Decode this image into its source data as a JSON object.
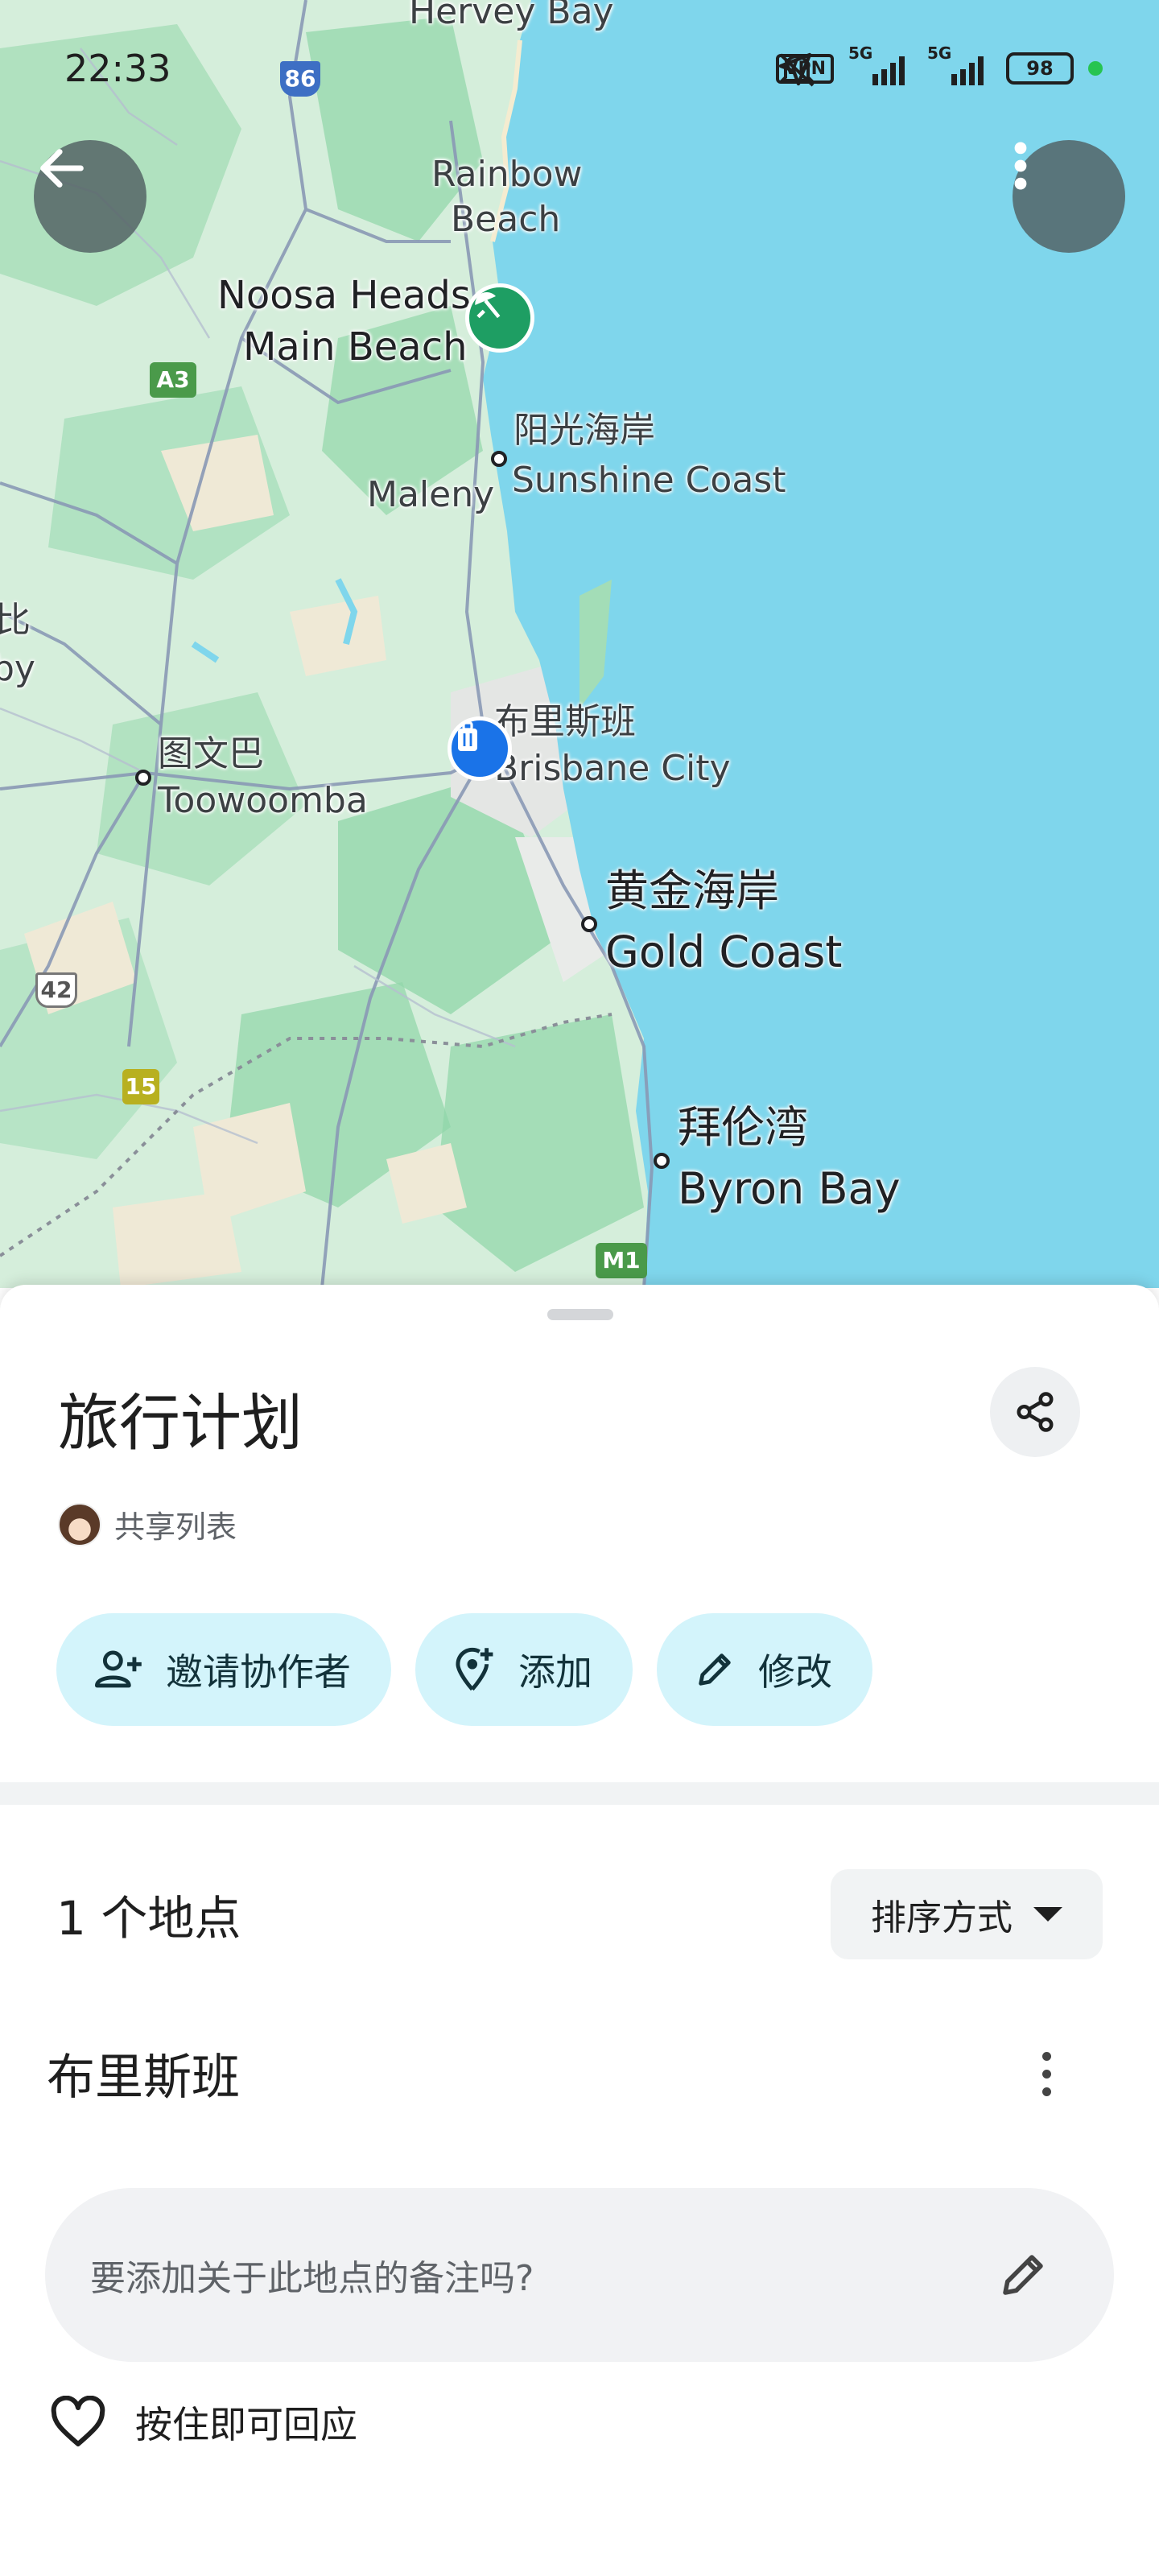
{
  "status_bar": {
    "time": "22:33",
    "vpn": "VPN",
    "net1": "5G",
    "net2": "5G",
    "battery": "98"
  },
  "map": {
    "labels": {
      "hervey_bay": "Hervey Bay",
      "rainbow_beach_1": "Rainbow",
      "rainbow_beach_2": "Beach",
      "noosa_1": "Noosa Heads",
      "noosa_2": "Main Beach",
      "sunshine_cn": "阳光海岸",
      "sunshine_en": "Sunshine Coast",
      "maleny": "Maleny",
      "edge_1": "比",
      "edge_2": "by",
      "brisbane_cn": "布里斯班",
      "brisbane_en": "Brisbane City",
      "toowoomba_cn": "图文巴",
      "toowoomba_en": "Toowoomba",
      "gold_cn": "黄金海岸",
      "gold_en": "Gold Coast",
      "byron_cn": "拜伦湾",
      "byron_en": "Byron Bay"
    },
    "shields": {
      "r86": "86",
      "a3": "A3",
      "r42": "42",
      "r15": "15",
      "m1": "M1"
    },
    "icons": {
      "back": "back-arrow-icon",
      "menu": "more-vert-icon",
      "beach_pin": "beach-umbrella-pin-icon",
      "saved_pin": "luggage-pin-icon"
    }
  },
  "sheet": {
    "title": "旅行计划",
    "shared_label": "共享列表",
    "actions": {
      "invite": "邀请协作者",
      "add": "添加",
      "edit": "修改"
    },
    "place_count": "1 个地点",
    "sort_label": "排序方式",
    "place_name": "布里斯班",
    "note_placeholder": "要添加关于此地点的备注吗?",
    "react_label": "按住即可回应"
  },
  "colors": {
    "ocean": "#7fd6ec",
    "land": "#cdebd7",
    "chip_bg": "#d3f4fb",
    "pin_blue": "#1a73e8",
    "pin_green": "#1e9e63"
  }
}
